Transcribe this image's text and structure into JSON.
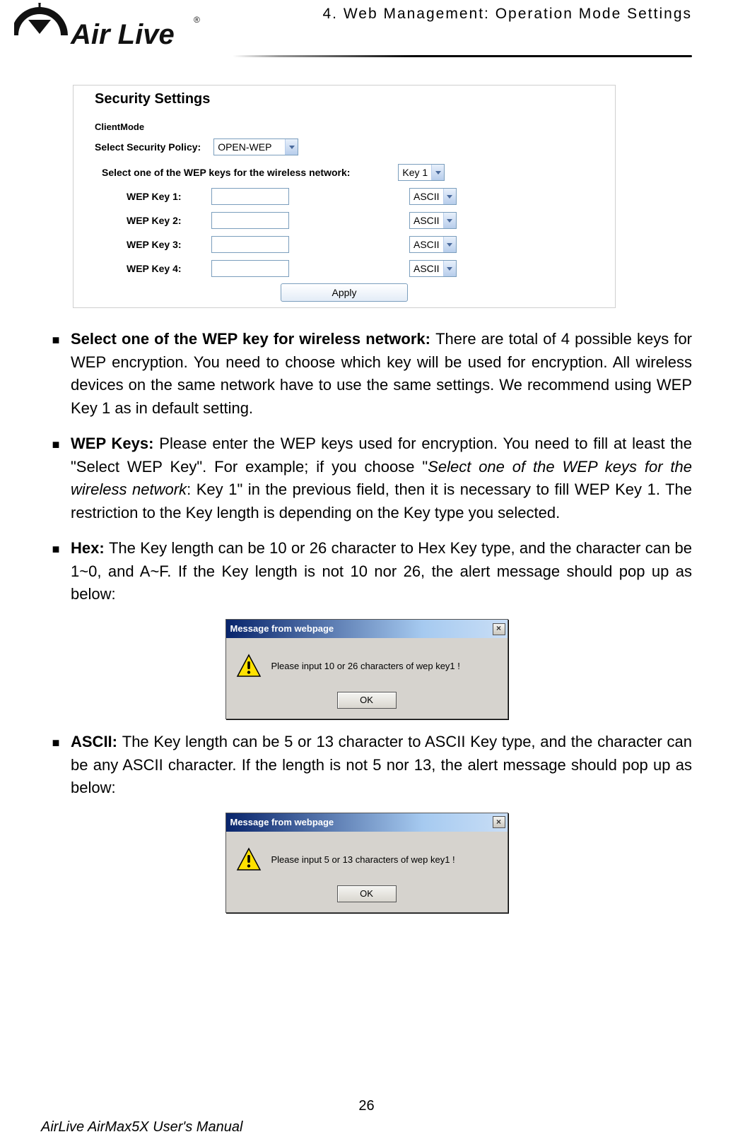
{
  "header": {
    "section_label": "4. Web Management: Operation Mode Settings",
    "logo_text_1": "Air Live",
    "logo_text_2": "®"
  },
  "security_panel": {
    "title": "Security Settings",
    "mode_label": "ClientMode",
    "policy_label": "Select Security Policy:",
    "policy_value": "OPEN-WEP",
    "select_key_label": "Select one of the WEP keys for the wireless network:",
    "select_key_value": "Key 1",
    "keys": [
      {
        "label": "WEP Key 1:",
        "type_value": "ASCII"
      },
      {
        "label": "WEP Key 2:",
        "type_value": "ASCII"
      },
      {
        "label": "WEP Key 3:",
        "type_value": "ASCII"
      },
      {
        "label": "WEP Key 4:",
        "type_value": "ASCII"
      }
    ],
    "apply_label": "Apply"
  },
  "bullets": {
    "b1_bold": "Select one of the WEP key for wireless network: ",
    "b1_text": "There are total of 4 possible keys for WEP encryption. You need to choose which key will be used for encryption. All wireless devices on the same network have to use the same settings. We recommend using WEP Key 1 as in default setting.",
    "b2_bold": "WEP Keys: ",
    "b2_text_a": "Please enter the WEP keys used for encryption. You need to fill at least the \"Select WEP Key\". For example; if you choose \"",
    "b2_italic": "Select one of the WEP keys for the wireless network",
    "b2_text_b": ": Key 1\" in the previous field, then it is necessary to fill WEP Key 1. The restriction to the Key length is depending on the Key type you selected.",
    "b3_bold": "Hex: ",
    "b3_text": "The Key length can be 10 or 26 character to Hex Key type, and the character can be 1~0, and A~F. If the Key length is not 10 nor 26, the alert message should pop up as below:",
    "b4_bold": "ASCII: ",
    "b4_text": "The Key length can be 5 or 13 character to ASCII Key type, and the character can be any ASCII character. If the length is not 5 nor 13, the alert message should pop up as below:"
  },
  "dialog1": {
    "title": "Message from webpage",
    "body": "Please input 10 or 26 characters of wep key1 !",
    "ok": "OK",
    "close": "×"
  },
  "dialog2": {
    "title": "Message from webpage",
    "body": "Please input 5 or 13 characters of wep key1 !",
    "ok": "OK",
    "close": "×"
  },
  "footer": {
    "page_num": "26",
    "manual": "AirLive AirMax5X User's Manual"
  }
}
